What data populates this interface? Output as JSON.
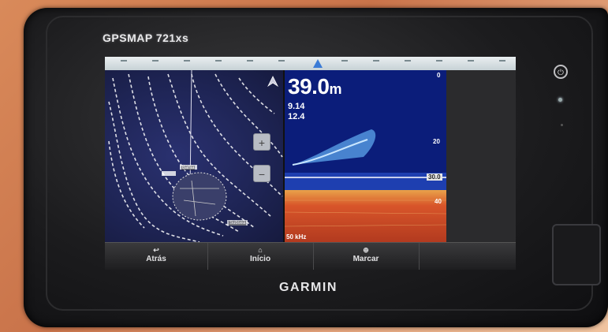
{
  "device": {
    "model": "GPSMAP 721xs",
    "brand": "GARMIN"
  },
  "sonar": {
    "depth_value": "39.0",
    "depth_unit": "m",
    "readout_1": "9.14",
    "readout_2": "12.4",
    "scale_top": "0",
    "scale_mid": "20",
    "scale_marker": "30.0",
    "scale_bottom": "40",
    "freq_label": "50 kHz"
  },
  "chart": {
    "label_1": "Bahia",
    "label_2": "Subsea"
  },
  "softkeys": [
    {
      "label": "Atrás",
      "icon": "back-arrow-icon"
    },
    {
      "label": "Início",
      "icon": "home-icon"
    },
    {
      "label": "Marcar",
      "icon": "mark-icon"
    },
    {
      "label": "",
      "icon": ""
    }
  ],
  "colors": {
    "sonar_water": "#0b1d7a",
    "sonar_bottom": "#d8552a",
    "chart_bg": "#1e2454"
  }
}
